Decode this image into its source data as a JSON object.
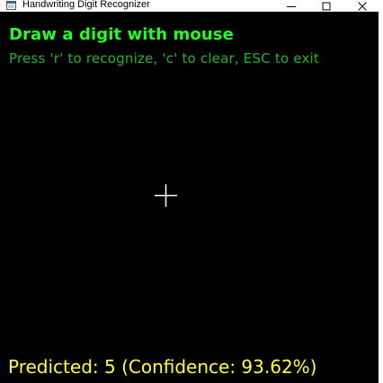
{
  "window": {
    "title": "Handwriting Digit Recognizer",
    "app_icon": "app-window-icon",
    "controls": {
      "minimize_icon": "minimize-icon",
      "maximize_icon": "maximize-icon",
      "close_icon": "close-icon"
    }
  },
  "canvas": {
    "heading": "Draw a digit with mouse",
    "instructions": "Press 'r' to recognize, 'c' to clear, ESC to exit",
    "cursor_icon": "crosshair-cursor-icon",
    "prediction": "Predicted: 5 (Confidence: 93.62%)"
  },
  "colors": {
    "background": "#000000",
    "heading": "#22ff22",
    "instructions": "#22b522",
    "prediction": "#ffff33",
    "cursor": "#ffffff"
  }
}
